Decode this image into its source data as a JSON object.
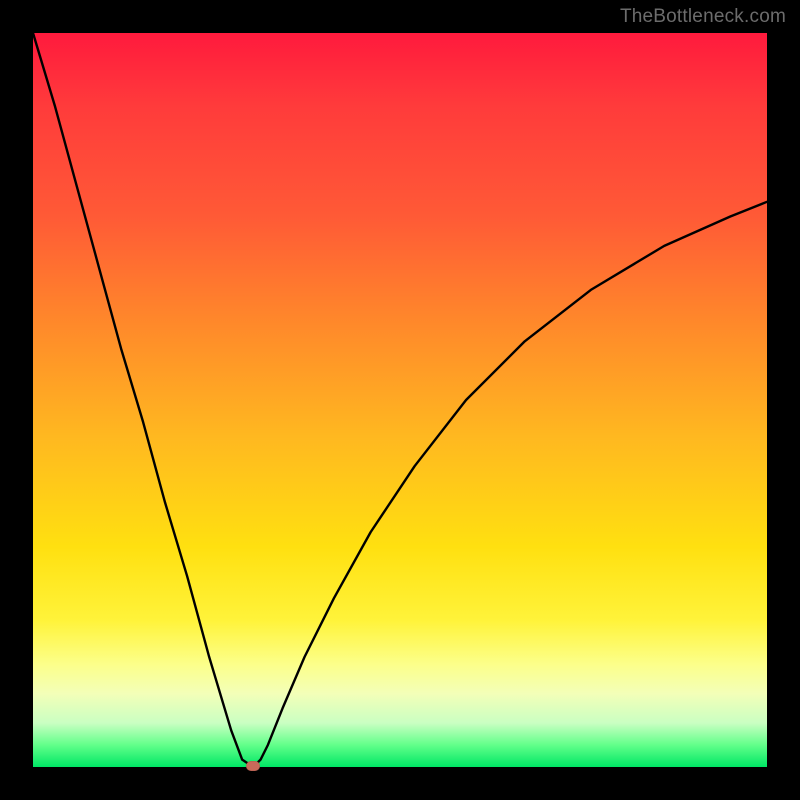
{
  "watermark": "TheBottleneck.com",
  "chart_data": {
    "type": "line",
    "title": "",
    "xlabel": "",
    "ylabel": "",
    "xlim": [
      0,
      100
    ],
    "ylim": [
      0,
      100
    ],
    "grid": false,
    "legend": false,
    "background_gradient": {
      "orientation": "vertical",
      "stops": [
        {
          "pos": 0,
          "color": "#ff1a3d"
        },
        {
          "pos": 25,
          "color": "#ff5a36"
        },
        {
          "pos": 55,
          "color": "#ffb820"
        },
        {
          "pos": 80,
          "color": "#fff33a"
        },
        {
          "pos": 94,
          "color": "#caffc2"
        },
        {
          "pos": 100,
          "color": "#00e765"
        }
      ]
    },
    "series": [
      {
        "name": "bottleneck-curve",
        "color": "#000000",
        "x": [
          0,
          3,
          6,
          9,
          12,
          15,
          18,
          21,
          24,
          27,
          28.5,
          30,
          31,
          32,
          34,
          37,
          41,
          46,
          52,
          59,
          67,
          76,
          86,
          95,
          100
        ],
        "y": [
          100,
          90,
          79,
          68,
          57,
          47,
          36,
          26,
          15,
          5,
          1,
          0,
          1,
          3,
          8,
          15,
          23,
          32,
          41,
          50,
          58,
          65,
          71,
          75,
          77
        ]
      }
    ],
    "markers": [
      {
        "name": "optimal-point",
        "x": 30,
        "y": 0,
        "color": "#c96a5a",
        "shape": "rounded-rect"
      }
    ]
  }
}
